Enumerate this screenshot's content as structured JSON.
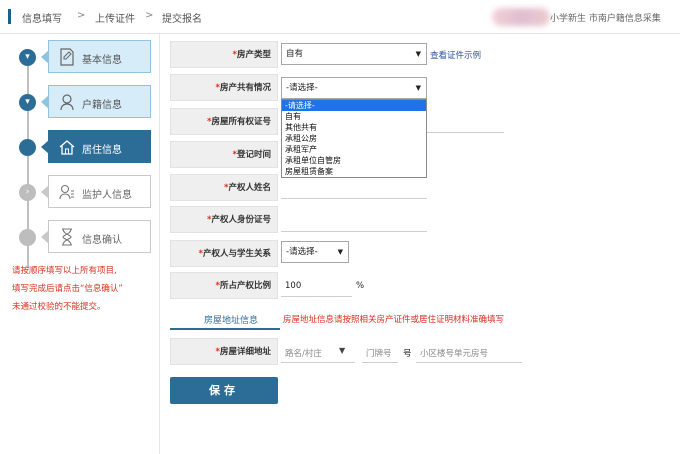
{
  "breadcrumb": {
    "steps": [
      "信息填写",
      "上传证件",
      "提交报名"
    ],
    "separator": ">"
  },
  "site_title": "小学新生 市南户籍信息采集",
  "sidebar": {
    "steps": [
      {
        "label": "基本信息",
        "icon": "document-edit-icon",
        "state": "done"
      },
      {
        "label": "户籍信息",
        "icon": "person-icon",
        "state": "done"
      },
      {
        "label": "居住信息",
        "icon": "house-icon",
        "state": "active"
      },
      {
        "label": "监护人信息",
        "icon": "guardian-icon",
        "state": "todo"
      },
      {
        "label": "信息确认",
        "icon": "hourglass-icon",
        "state": "todo"
      }
    ],
    "notes": [
      "请按顺序填写以上所有项目,",
      "填写完成后请点击“信息确认”",
      "未通过校验的不能提交。"
    ]
  },
  "form": {
    "property_type": {
      "label": "房产类型",
      "value": "自有",
      "link": "查看证件示例"
    },
    "co_ownership": {
      "label": "房产共有情况",
      "value": "-请选择-",
      "options": [
        "-请选择-",
        "自有",
        "其他共有",
        "承租公房",
        "承租军产",
        "承租单位自管房",
        "房屋租赁备案"
      ]
    },
    "cert_no": {
      "label": "房屋所有权证号"
    },
    "reg_time": {
      "label": "登记时间"
    },
    "owner_name": {
      "label": "产权人姓名"
    },
    "owner_id": {
      "label": "产权人身份证号"
    },
    "relation": {
      "label": "产权人与学生关系",
      "value": "-请选择-"
    },
    "share": {
      "label": "所占产权比例",
      "value": "100",
      "unit": "%"
    },
    "address_tab": "房屋地址信息",
    "address_hint": "房屋地址信息请按照相关房产证件或居住证明材料准确填写",
    "address": {
      "label": "房屋详细地址",
      "road_placeholder": "路名/村庄",
      "door_placeholder": "门牌号",
      "mark": "号",
      "unit_placeholder": "小区楼号单元房号"
    }
  },
  "save_label": "保存",
  "colors": {
    "primary": "#2c6d97",
    "light_step": "#d6edf9",
    "required": "#d9301f",
    "link": "#2d4f9a",
    "highlight": "#1e73e6"
  }
}
